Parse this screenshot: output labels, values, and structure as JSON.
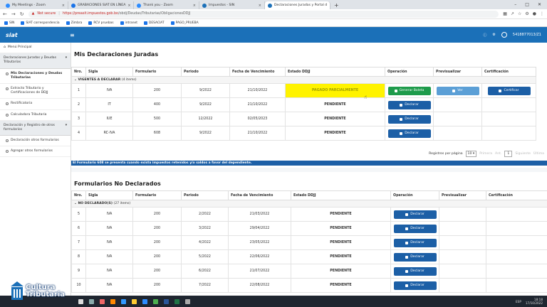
{
  "browser": {
    "tabs": [
      {
        "label": "My Meetings - Zoom",
        "color": "#2d8cff"
      },
      {
        "label": "GRABACIONES SIAT EN LÍNEA",
        "color": "#1a73e8"
      },
      {
        "label": "Thank you - Zoom",
        "color": "#2d8cff"
      },
      {
        "label": "Impuestos - SIN",
        "color": "#1b70b8"
      },
      {
        "label": "Declaraciones Juradas y Portal d",
        "color": "#1b70b8",
        "active": true
      }
    ],
    "new_tab": "+",
    "url_warning": "Not secure",
    "url_host": "https://preasit.impuestos.gob.bo",
    "url_path": "/obdj/Deudas/Tributarias/ObligacionesDDJJ",
    "bookmarks": [
      "SIN",
      "SIAT correspondencia",
      "Zimbra",
      "RCV pruebas",
      "intranet",
      "DESACIAT",
      "PAGO_PRUEBA"
    ]
  },
  "app": {
    "logo": "siat",
    "menu_icon": "≡",
    "user_name": "5418877013/Z1"
  },
  "sidebar": {
    "home": "Menú Principal",
    "groups": [
      {
        "label": "Declaraciones Juradas y Deudas Tributarias",
        "items": [
          {
            "label": "Mis Declaraciones y Deudas Tributarias",
            "selected": true
          },
          {
            "label": "Extracto Tributario y Certificaciones de DDJJ"
          },
          {
            "label": "Rectificatoria"
          },
          {
            "label": "Calculadora Tributaria"
          }
        ]
      },
      {
        "label": "Declaración y Registro de otros formularios",
        "items": [
          {
            "label": "Declaración otros formularios"
          },
          {
            "label": "Agregar otros formularios"
          }
        ]
      }
    ]
  },
  "declaraciones": {
    "title": "Mis Declaraciones Juradas",
    "headers": [
      "Nro.",
      "Sigla",
      "Formulario",
      "Periodo",
      "Fecha de Vencimiento",
      "Estado DDJJ",
      "Operación",
      "Previsualizar",
      "Certificación"
    ],
    "group_label": "VIGENTES A DECLARAR",
    "group_count": "(4 items)",
    "rows": [
      {
        "nro": "1",
        "sigla": "IVA",
        "form": "200",
        "periodo": "9/2022",
        "venc": "21/10/2022",
        "estado": "PAGADO PARCIALMENTE",
        "op": "Generar Boleta",
        "prev": "Ver",
        "cert": "Certificar"
      },
      {
        "nro": "2",
        "sigla": "IT",
        "form": "400",
        "periodo": "9/2022",
        "venc": "21/10/2022",
        "estado": "PENDIENTE",
        "op": "Declarar"
      },
      {
        "nro": "3",
        "sigla": "IUE",
        "form": "500",
        "periodo": "12/2022",
        "venc": "02/05/2023",
        "estado": "PENDIENTE",
        "op": "Declarar"
      },
      {
        "nro": "4",
        "sigla": "RC-IVA",
        "form": "608",
        "periodo": "9/2022",
        "venc": "21/10/2022",
        "estado": "PENDIENTE",
        "op": "Declarar"
      }
    ],
    "pager": {
      "label": "Registros por página",
      "size": "10",
      "first": "Primera",
      "prev": "Ant.",
      "page": "1",
      "next": "Siguiente",
      "last": "Última"
    },
    "note": "El Formulario 608 se presenta cuando exista impuestos retenidos y/o saldos a favor del dependiente."
  },
  "no_declarados": {
    "title": "Formularios No Declarados",
    "headers": [
      "Nro.",
      "Sigla",
      "Formulario",
      "Periodo",
      "Fecha de Vencimiento",
      "Estado DDJJ",
      "Operación",
      "Previsualizar",
      "Certificación"
    ],
    "group_label": "NO DECLARADO(S)",
    "group_count": "(27 items)",
    "rows": [
      {
        "nro": "5",
        "sigla": "IVA",
        "form": "200",
        "periodo": "2/2022",
        "venc": "21/03/2022",
        "estado": "PENDIENTE",
        "op": "Declarar"
      },
      {
        "nro": "6",
        "sigla": "IVA",
        "form": "200",
        "periodo": "3/2022",
        "venc": "29/04/2022",
        "estado": "PENDIENTE",
        "op": "Declarar"
      },
      {
        "nro": "7",
        "sigla": "IVA",
        "form": "200",
        "periodo": "4/2022",
        "venc": "23/05/2022",
        "estado": "PENDIENTE",
        "op": "Declarar"
      },
      {
        "nro": "8",
        "sigla": "IVA",
        "form": "200",
        "periodo": "5/2022",
        "venc": "22/06/2022",
        "estado": "PENDIENTE",
        "op": "Declarar"
      },
      {
        "nro": "9",
        "sigla": "IVA",
        "form": "200",
        "periodo": "6/2022",
        "venc": "21/07/2022",
        "estado": "PENDIENTE",
        "op": "Declarar"
      },
      {
        "nro": "10",
        "sigla": "IVA",
        "form": "200",
        "periodo": "7/2022",
        "venc": "22/08/2022",
        "estado": "PENDIENTE",
        "op": "Declarar"
      }
    ]
  },
  "watermark": {
    "line1": "Cultura",
    "line2": "Tributaria"
  },
  "tray": {
    "lang": "ESP",
    "time": "18:18",
    "date": "17/10/2022"
  },
  "colors": {
    "primary": "#1b70b8",
    "button": "#1c5fa6",
    "green": "#1e9b4b",
    "light_blue": "#5b9fd6",
    "highlight": "#fff300"
  }
}
